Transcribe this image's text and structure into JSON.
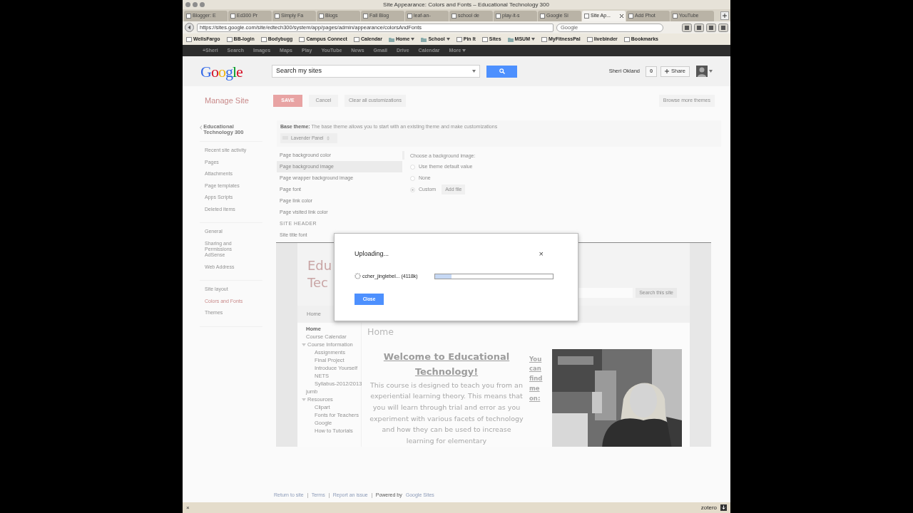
{
  "browser": {
    "title": "Site Appearance: Colors and Fonts – Educational Technology 300",
    "tabs": [
      {
        "label": "Blogger: E",
        "selected": false
      },
      {
        "label": "Ed300 Pr",
        "selected": false
      },
      {
        "label": "Simply Fa",
        "selected": false
      },
      {
        "label": "Blogs",
        "selected": false
      },
      {
        "label": "Fall Blog",
        "selected": false
      },
      {
        "label": "leaf-an-",
        "selected": false
      },
      {
        "label": "school de",
        "selected": false
      },
      {
        "label": "play-it-s",
        "selected": false
      },
      {
        "label": "Google Si",
        "selected": false
      },
      {
        "label": "Site Ap...",
        "selected": true
      },
      {
        "label": "Add Phot",
        "selected": false
      },
      {
        "label": "YouTube",
        "selected": false
      }
    ],
    "url": "https://sites.google.com/site/edtech300/system/app/pages/admin/appearance/colorsAndFonts",
    "search_placeholder": "Google",
    "bookmarks": [
      {
        "label": "WellsFargo",
        "kind": "link"
      },
      {
        "label": "BB-login",
        "kind": "link"
      },
      {
        "label": "Bodybugg",
        "kind": "link"
      },
      {
        "label": "Campus Connect",
        "kind": "link"
      },
      {
        "label": "Calendar",
        "kind": "link"
      },
      {
        "label": "Home",
        "kind": "folder"
      },
      {
        "label": "School",
        "kind": "folder"
      },
      {
        "label": "Pin It",
        "kind": "link"
      },
      {
        "label": "Sites",
        "kind": "link"
      },
      {
        "label": "MSUM",
        "kind": "folder"
      },
      {
        "label": "MyFitnessPal",
        "kind": "link"
      },
      {
        "label": "livebinder",
        "kind": "link"
      },
      {
        "label": "Bookmarks",
        "kind": "link"
      }
    ],
    "status_bar": {
      "close": "×",
      "addon": "zotero"
    }
  },
  "google_bar": [
    "+Sheri",
    "Search",
    "Images",
    "Maps",
    "Play",
    "YouTube",
    "News",
    "Gmail",
    "Drive",
    "Calendar",
    "More"
  ],
  "header": {
    "logo": "Google",
    "search": {
      "placeholder": "Search my sites"
    },
    "user": "Sheri Okland",
    "count": "0",
    "share": "Share"
  },
  "toolbar": {
    "title": "Manage Site",
    "save": "SAVE",
    "cancel": "Cancel",
    "clear": "Clear all customizations",
    "browse": "Browse more themes"
  },
  "sidebar": {
    "site": "Educational Technology 300",
    "groups": [
      [
        {
          "label": "Recent site activity",
          "selected": false
        },
        {
          "label": "Pages",
          "selected": false
        },
        {
          "label": "Attachments",
          "selected": false
        },
        {
          "label": "Page templates",
          "selected": false
        },
        {
          "label": "Apps Scripts",
          "selected": false
        },
        {
          "label": "Deleted items",
          "selected": false
        }
      ],
      [
        {
          "label": "General",
          "selected": false
        },
        {
          "label": "Sharing and Permissions",
          "selected": false
        },
        {
          "label": "AdSense",
          "selected": false
        },
        {
          "label": "Web Address",
          "selected": false
        }
      ],
      [
        {
          "label": "Site layout",
          "selected": false
        },
        {
          "label": "Colors and Fonts",
          "selected": true
        },
        {
          "label": "Themes",
          "selected": false
        }
      ]
    ]
  },
  "base_theme": {
    "label": "Base theme:",
    "text": "The base theme allows you to start with an existing theme and make customizations",
    "theme": "Lavender Panel"
  },
  "settings": [
    {
      "label": "Page background color",
      "kind": "item",
      "selected": false
    },
    {
      "label": "Page background image",
      "kind": "item",
      "selected": true
    },
    {
      "label": "Page wrapper background image",
      "kind": "item",
      "selected": false
    },
    {
      "label": "Page font",
      "kind": "item",
      "selected": false
    },
    {
      "label": "Page link color",
      "kind": "item",
      "selected": false
    },
    {
      "label": "Page visited link color",
      "kind": "item",
      "selected": false
    },
    {
      "label": "SITE HEADER",
      "kind": "heading",
      "selected": false
    },
    {
      "label": "Site title font",
      "kind": "item",
      "selected": false
    }
  ],
  "background_panel": {
    "title": "Choose a background image:",
    "options": [
      {
        "label": "Use theme default value",
        "selected": false
      },
      {
        "label": "None",
        "selected": false
      },
      {
        "label": "Custom",
        "selected": true
      }
    ],
    "add_file": "Add file"
  },
  "preview": {
    "title_lines": [
      "Edu",
      "Tec"
    ],
    "search_button": "Search this site",
    "nav": [
      "Home"
    ],
    "sidebar": [
      {
        "label": "Home",
        "selected": true
      },
      {
        "label": "Course Calendar",
        "selected": false
      },
      {
        "label": "Course Information",
        "selected": false,
        "expanded": true,
        "children": [
          {
            "label": "Assignments",
            "selected": false
          },
          {
            "label": "Final Project",
            "selected": false
          },
          {
            "label": "Introduce Yourself",
            "selected": false
          },
          {
            "label": "NETS",
            "selected": false
          },
          {
            "label": "Syllabus-2012/2013",
            "selected": false
          }
        ]
      },
      {
        "label": "jumb",
        "selected": false
      },
      {
        "label": "Resources",
        "selected": false,
        "expanded": true,
        "children": [
          {
            "label": "Clipart",
            "selected": false
          },
          {
            "label": "Fonts for Teachers",
            "selected": false
          },
          {
            "label": "Google",
            "selected": false
          },
          {
            "label": "How to Tutorials",
            "selected": false
          }
        ]
      }
    ],
    "heading": "Home",
    "welcome": "Welcome to Educational Technology!",
    "body": "This course is designed to teach you from an experiential learning theory.  This means that you will learn through trial and error as you experiment with various facets of technology and how they can be used to increase learning for elementary",
    "find_me": "You can find me on:",
    "photo": {
      "kind": "picture"
    }
  },
  "dialog": {
    "title": "Uploading...",
    "close_icon": "×",
    "file": "ccher_jinglebel... (4118k)",
    "level": 0.14,
    "button": "Close"
  },
  "footer": {
    "links": [
      "Return to site",
      "Terms",
      "Report an issue"
    ],
    "powered": "Powered by",
    "brand": "Google Sites"
  }
}
